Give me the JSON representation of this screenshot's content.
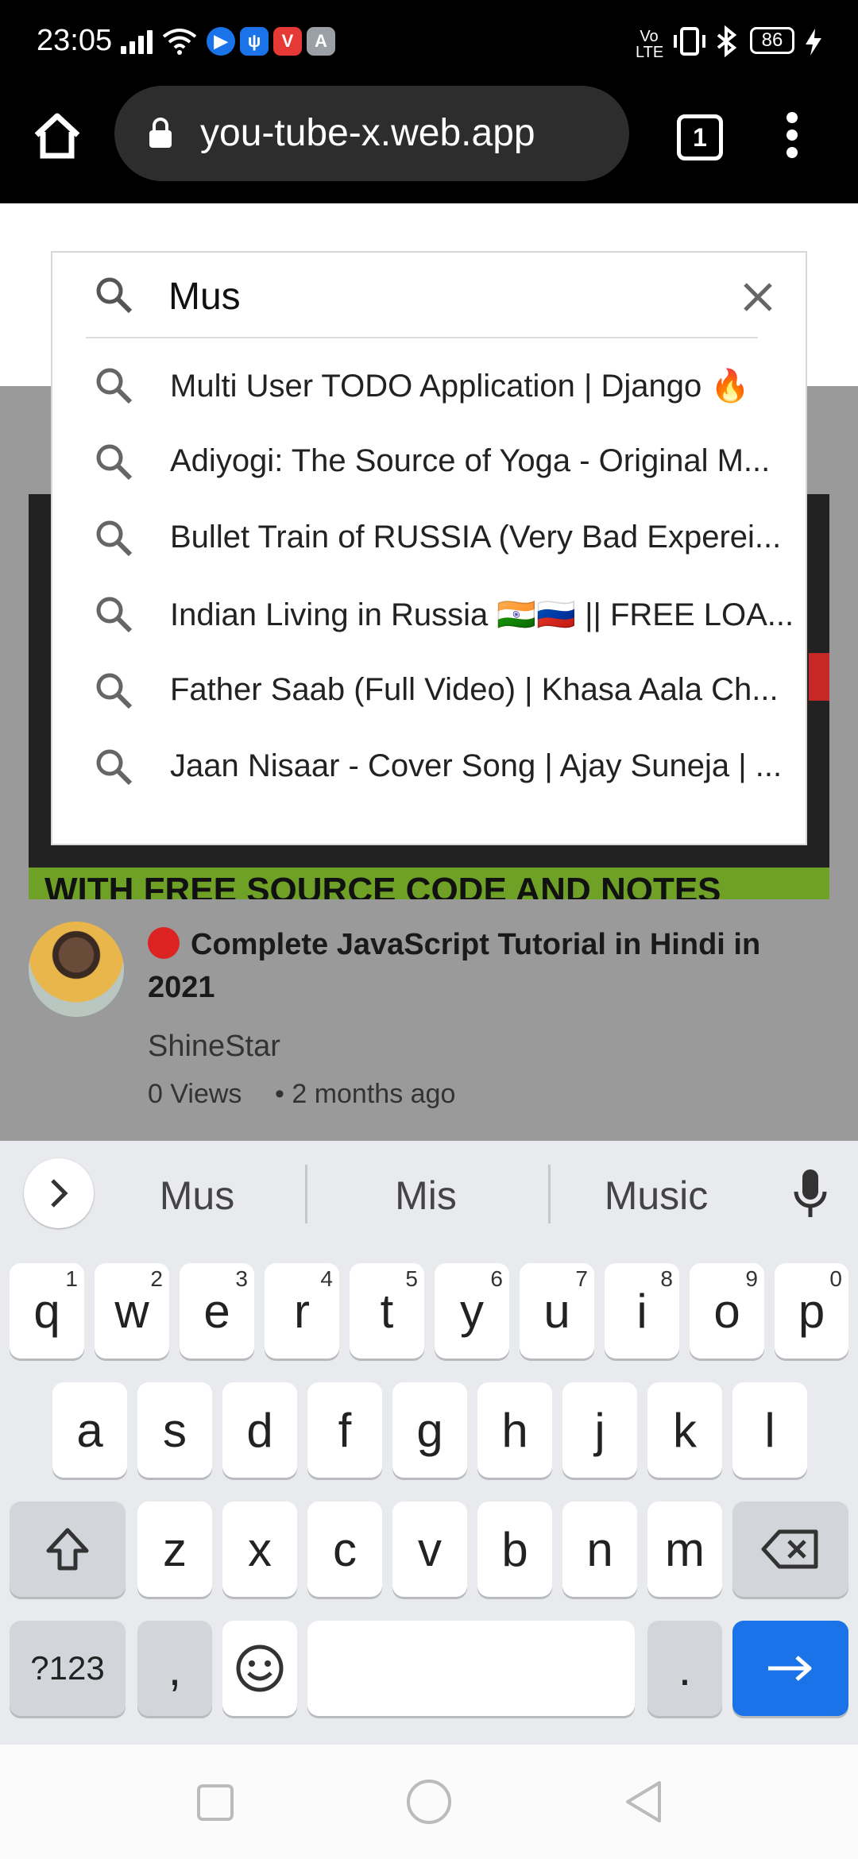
{
  "status": {
    "time": "23:05",
    "net": "Vo LTE",
    "battery": "86"
  },
  "browser": {
    "url": "you-tube-x.web.app",
    "tab_count": "1"
  },
  "search": {
    "value": "Mus",
    "suggestions": [
      "Multi User TODO Application | Django 🔥",
      "Adiyogi: The Source of Yoga - Original M...",
      "Bullet Train of RUSSIA (Very Bad Experei...",
      "Indian Living in Russia 🇮🇳🇷🇺 || FREE LOA...",
      "Father Saab (Full Video) | Khasa Aala Ch...",
      "Jaan Nisaar - Cover Song | Ajay Suneja | ..."
    ]
  },
  "video": {
    "thumb_caption": "WITH FREE SOURCE CODE AND NOTES",
    "title": "Complete JavaScript Tutorial in Hindi in 2021",
    "channel": "ShineStar",
    "views": "0 Views",
    "age": "• 2 months ago"
  },
  "keyboard": {
    "suggestions": [
      "Mus",
      "Mis",
      "Music"
    ],
    "row1": [
      "q",
      "w",
      "e",
      "r",
      "t",
      "y",
      "u",
      "i",
      "o",
      "p"
    ],
    "row1_hints": [
      "1",
      "2",
      "3",
      "4",
      "5",
      "6",
      "7",
      "8",
      "9",
      "0"
    ],
    "row2": [
      "a",
      "s",
      "d",
      "f",
      "g",
      "h",
      "j",
      "k",
      "l"
    ],
    "row3": [
      "z",
      "x",
      "c",
      "v",
      "b",
      "n",
      "m"
    ],
    "symbols": "?123",
    "comma": ",",
    "period": "."
  },
  "colors": {
    "accent": "#1a73e8",
    "status_bg": "#000000",
    "overlay": "#9a9a9a"
  }
}
